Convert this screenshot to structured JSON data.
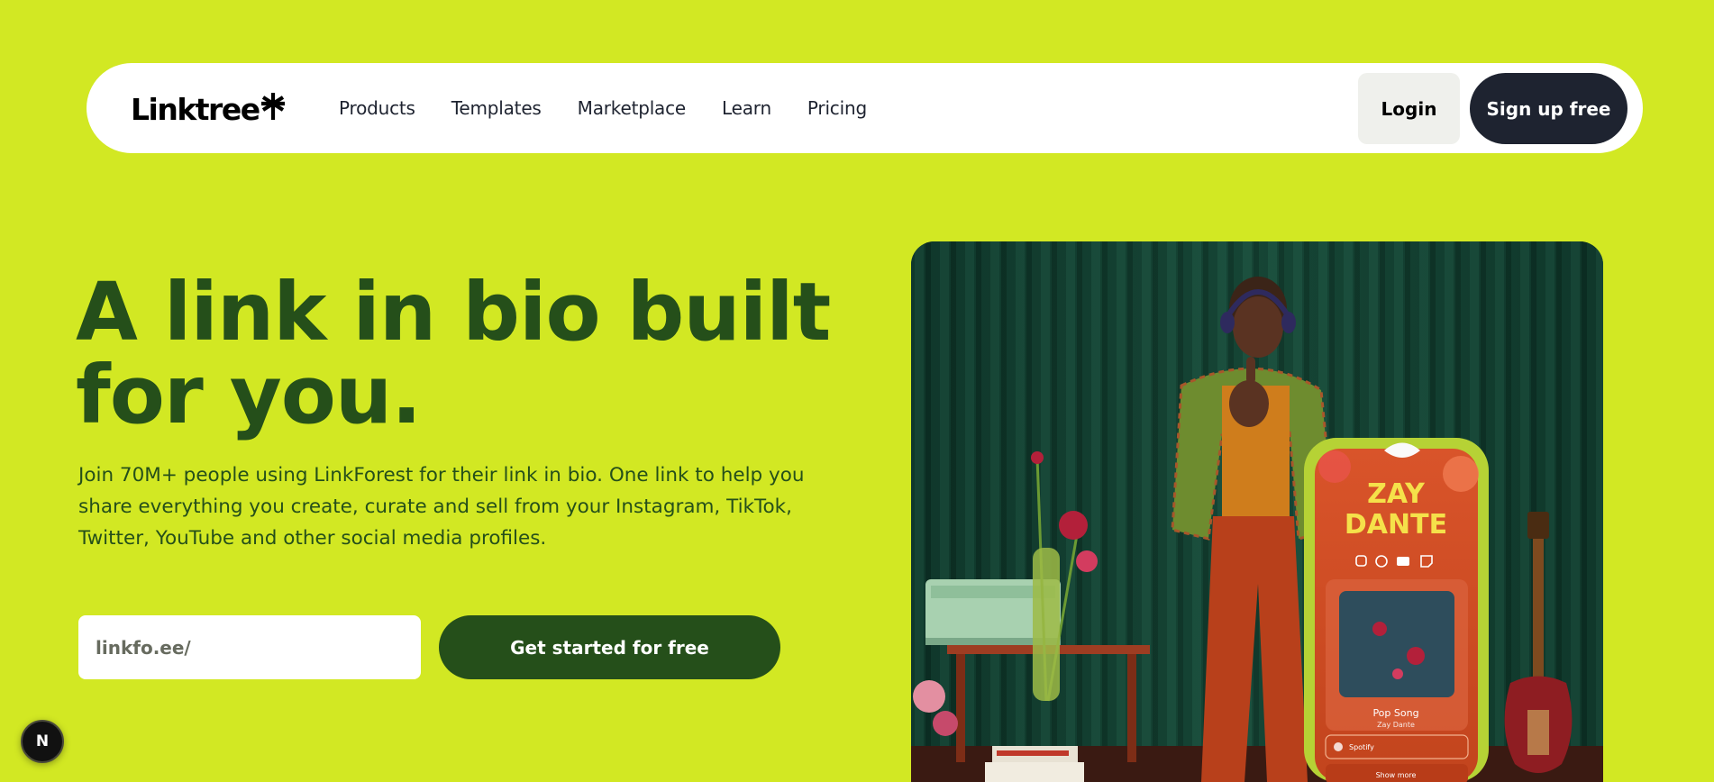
{
  "brand": {
    "name": "Linktree"
  },
  "nav": {
    "links": [
      {
        "label": "Products"
      },
      {
        "label": "Templates"
      },
      {
        "label": "Marketplace"
      },
      {
        "label": "Learn"
      },
      {
        "label": "Pricing"
      }
    ],
    "login_label": "Login",
    "signup_label": "Sign up free"
  },
  "hero": {
    "headline_line1": "A link in bio built",
    "headline_line2": "for you.",
    "subtext": "Join 70M+ people using LinkForest for their link in bio. One link to help you share everything you create, curate and sell from your Instagram, TikTok, Twitter, YouTube and other social media profiles.",
    "input_placeholder": "linkfo.ee/",
    "cta_label": "Get started for free"
  },
  "badge": {
    "label": "N"
  },
  "phone_preview": {
    "artist_line1": "ZAY",
    "artist_line2": "DANTE",
    "song_title": "Pop Song",
    "song_artist": "Zay Dante",
    "link_label": "Spotify",
    "more_label": "Show more",
    "social_icons": [
      "instagram-icon",
      "spotify-icon",
      "youtube-icon",
      "twitch-icon"
    ]
  },
  "colors": {
    "background": "#d2e823",
    "headline": "#254f1a",
    "signup_button": "#1e2330",
    "cta_button": "#254f1a",
    "curtain": "#0f3a2c"
  }
}
